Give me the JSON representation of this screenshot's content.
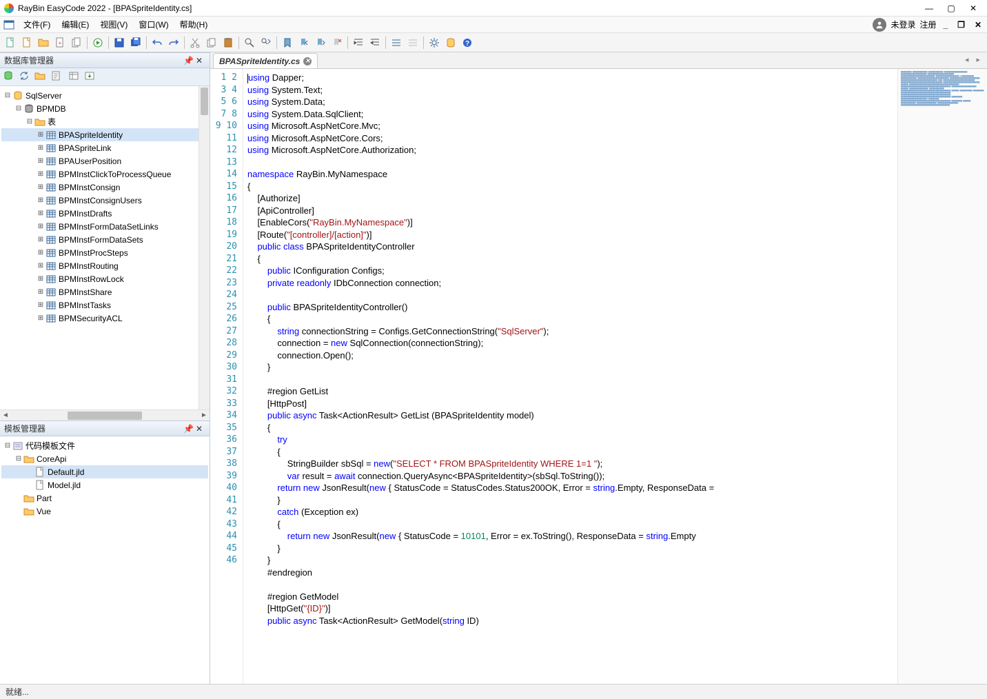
{
  "window": {
    "title": "RayBin EasyCode 2022 - [BPASpriteIdentity.cs]"
  },
  "menu": {
    "file": "文件(F)",
    "edit": "编辑(E)",
    "view": "视图(V)",
    "window": "窗口(W)",
    "help": "帮助(H)",
    "not_logged_in": "未登录",
    "register": "注册"
  },
  "panels": {
    "db_manager": "数据库管理器",
    "tpl_manager": "模板管理器"
  },
  "db_tree": {
    "root": "SqlServer",
    "db": "BPMDB",
    "tables_label": "表",
    "tables": [
      "BPASpriteIdentity",
      "BPASpriteLink",
      "BPAUserPosition",
      "BPMInstClickToProcessQueue",
      "BPMInstConsign",
      "BPMInstConsignUsers",
      "BPMInstDrafts",
      "BPMInstFormDataSetLinks",
      "BPMInstFormDataSets",
      "BPMInstProcSteps",
      "BPMInstRouting",
      "BPMInstRowLock",
      "BPMInstShare",
      "BPMInstTasks",
      "BPMSecurityACL"
    ]
  },
  "tpl_tree": {
    "root": "代码模板文件",
    "coreapi": "CoreApi",
    "coreapi_items": [
      "Default.jld",
      "Model.jld"
    ],
    "part": "Part",
    "vue": "Vue"
  },
  "tab": {
    "label": "BPASpriteIdentity.cs"
  },
  "code_lines": [
    [
      [
        "kw",
        "using"
      ],
      [
        "",
        " Dapper;"
      ]
    ],
    [
      [
        "kw",
        "using"
      ],
      [
        "",
        " System.Text;"
      ]
    ],
    [
      [
        "kw",
        "using"
      ],
      [
        "",
        " System.Data;"
      ]
    ],
    [
      [
        "kw",
        "using"
      ],
      [
        "",
        " System.Data.SqlClient;"
      ]
    ],
    [
      [
        "kw",
        "using"
      ],
      [
        "",
        " Microsoft.AspNetCore.Mvc;"
      ]
    ],
    [
      [
        "kw",
        "using"
      ],
      [
        "",
        " Microsoft.AspNetCore.Cors;"
      ]
    ],
    [
      [
        "kw",
        "using"
      ],
      [
        "",
        " Microsoft.AspNetCore.Authorization;"
      ]
    ],
    [
      [
        "",
        ""
      ]
    ],
    [
      [
        "kw",
        "namespace"
      ],
      [
        "",
        " RayBin.MyNamespace"
      ]
    ],
    [
      [
        "",
        "{"
      ]
    ],
    [
      [
        "",
        "    [Authorize]"
      ]
    ],
    [
      [
        "",
        "    [ApiController]"
      ]
    ],
    [
      [
        "",
        "    [EnableCors("
      ],
      [
        "str",
        "\"RayBin.MyNamespace\""
      ],
      [
        "",
        ")]"
      ]
    ],
    [
      [
        "",
        "    [Route("
      ],
      [
        "str",
        "\"[controller]/[action]\""
      ],
      [
        "",
        ")]"
      ]
    ],
    [
      [
        "",
        "    "
      ],
      [
        "kw",
        "public class"
      ],
      [
        "",
        " BPASpriteIdentityController"
      ]
    ],
    [
      [
        "",
        "    {"
      ]
    ],
    [
      [
        "",
        "        "
      ],
      [
        "kw",
        "public"
      ],
      [
        "",
        " IConfiguration Configs;"
      ]
    ],
    [
      [
        "",
        "        "
      ],
      [
        "kw",
        "private readonly"
      ],
      [
        "",
        " IDbConnection connection;"
      ]
    ],
    [
      [
        "",
        ""
      ]
    ],
    [
      [
        "",
        "        "
      ],
      [
        "kw",
        "public"
      ],
      [
        "",
        " BPASpriteIdentityController()"
      ]
    ],
    [
      [
        "",
        "        {"
      ]
    ],
    [
      [
        "",
        "            "
      ],
      [
        "kw",
        "string"
      ],
      [
        "",
        " connectionString = Configs.GetConnectionString("
      ],
      [
        "str",
        "\"SqlServer\""
      ],
      [
        "",
        ");"
      ]
    ],
    [
      [
        "",
        "            connection = "
      ],
      [
        "kw",
        "new"
      ],
      [
        "",
        " SqlConnection(connectionString);"
      ]
    ],
    [
      [
        "",
        "            connection.Open();"
      ]
    ],
    [
      [
        "",
        "        }"
      ]
    ],
    [
      [
        "",
        ""
      ]
    ],
    [
      [
        "",
        "        #region GetList"
      ]
    ],
    [
      [
        "",
        "        [HttpPost]"
      ]
    ],
    [
      [
        "",
        "        "
      ],
      [
        "kw",
        "public async"
      ],
      [
        "",
        " Task<ActionResult> GetList (BPASpriteIdentity model)"
      ]
    ],
    [
      [
        "",
        "        {"
      ]
    ],
    [
      [
        "",
        "            "
      ],
      [
        "kw",
        "try"
      ]
    ],
    [
      [
        "",
        "            {"
      ]
    ],
    [
      [
        "",
        "                StringBuilder sbSql = "
      ],
      [
        "kw",
        "new"
      ],
      [
        "",
        "("
      ],
      [
        "str",
        "\"SELECT * FROM BPASpriteIdentity WHERE 1=1 \""
      ],
      [
        "",
        ");"
      ]
    ],
    [
      [
        "",
        "                "
      ],
      [
        "kw",
        "var"
      ],
      [
        "",
        " result = "
      ],
      [
        "kw",
        "await"
      ],
      [
        "",
        " connection.QueryAsync<BPASpriteIdentity>(sbSql.ToString());"
      ]
    ],
    [
      [
        "",
        "            "
      ],
      [
        "kw",
        "return new"
      ],
      [
        "",
        " JsonResult("
      ],
      [
        "kw",
        "new"
      ],
      [
        "",
        " { StatusCode = StatusCodes.Status200OK, Error = "
      ],
      [
        "kw",
        "string"
      ],
      [
        "",
        ".Empty, ResponseData = "
      ]
    ],
    [
      [
        "",
        "            }"
      ]
    ],
    [
      [
        "",
        "            "
      ],
      [
        "kw",
        "catch"
      ],
      [
        "",
        " (Exception ex)"
      ]
    ],
    [
      [
        "",
        "            {"
      ]
    ],
    [
      [
        "",
        "                "
      ],
      [
        "kw",
        "return new"
      ],
      [
        "",
        " JsonResult("
      ],
      [
        "kw",
        "new"
      ],
      [
        "",
        " { StatusCode = "
      ],
      [
        "num",
        "10101"
      ],
      [
        "",
        ", Error = ex.ToString(), ResponseData = "
      ],
      [
        "kw",
        "string"
      ],
      [
        "",
        ".Empty"
      ]
    ],
    [
      [
        "",
        "            }"
      ]
    ],
    [
      [
        "",
        "        }"
      ]
    ],
    [
      [
        "",
        "        #endregion"
      ]
    ],
    [
      [
        "",
        ""
      ]
    ],
    [
      [
        "",
        "        #region GetModel"
      ]
    ],
    [
      [
        "",
        "        [HttpGet("
      ],
      [
        "str",
        "\"{ID}\""
      ],
      [
        "",
        ")]"
      ]
    ],
    [
      [
        "",
        "        "
      ],
      [
        "kw",
        "public async"
      ],
      [
        "",
        " Task<ActionResult> GetModel("
      ],
      [
        "kw",
        "string"
      ],
      [
        "",
        " ID)"
      ]
    ]
  ],
  "status": {
    "text": "就绪..."
  }
}
